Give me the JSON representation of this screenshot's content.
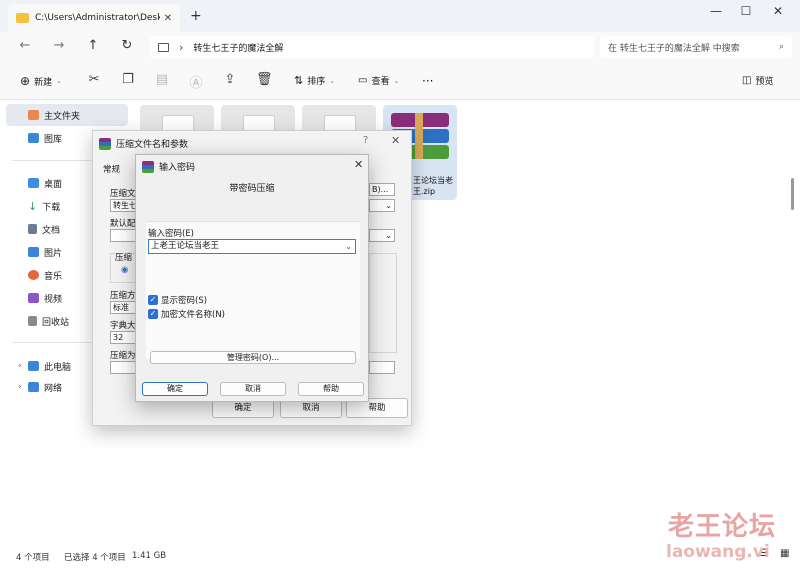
{
  "window": {
    "tab_title": "C:\\Users\\Administrator\\Deskto",
    "new_tab": "+",
    "minimize": "—",
    "maximize": "☐",
    "close": "✕"
  },
  "address": {
    "breadcrumb": "转生七王子的魔法全解",
    "search_placeholder": "在 转生七王子的魔法全解 中搜索"
  },
  "toolbar": {
    "new_label": "新建",
    "sort_label": "排序",
    "view_label": "查看",
    "more": "···",
    "preview_label": "预览"
  },
  "sidebar": {
    "items": [
      {
        "label": "主文件夹",
        "color": "#e8884f"
      },
      {
        "label": "图库",
        "color": "#3a86d8"
      },
      {
        "label": "桌面",
        "color": "#3d8ee0"
      },
      {
        "label": "下载",
        "color": "#2e9e57"
      },
      {
        "label": "文档",
        "color": "#6c7d92"
      },
      {
        "label": "图片",
        "color": "#3a86d8"
      },
      {
        "label": "音乐",
        "color": "#e5663f"
      },
      {
        "label": "视频",
        "color": "#8b56c9"
      },
      {
        "label": "回收站",
        "color": "#8a8a8a"
      },
      {
        "label": "此电脑",
        "color": "#3a86d8"
      },
      {
        "label": "网络",
        "color": "#3a86d8"
      }
    ]
  },
  "files": {
    "rar_label": "王论坛当老王.zip"
  },
  "status": {
    "count": "4 个项目",
    "selected": "已选择 4 个项目",
    "size": "1.41 GB"
  },
  "archive_dialog": {
    "title": "压缩文件名和参数",
    "help_q": "?",
    "close": "✕",
    "tab_general": "常规",
    "label_archive": "压缩文",
    "archive_name": "转生七",
    "label_default": "默认配",
    "label_format": "压缩",
    "label_method": "压缩方",
    "method_value": "标准",
    "label_dict": "字典大",
    "dict_value": "32",
    "label_split": "压缩为",
    "browse_btn": "B)...",
    "ok": "确定",
    "cancel": "取消",
    "help": "帮助"
  },
  "password_dialog": {
    "title": "输入密码",
    "close": "✕",
    "heading": "带密码压缩",
    "label_password": "输入密码(E)",
    "password_value": "上老王论坛当老王",
    "show_password": "显示密码(S)",
    "encrypt_names": "加密文件名称(N)",
    "manage_btn": "管理密码(O)...",
    "ok": "确定",
    "cancel": "取消",
    "help": "帮助"
  },
  "watermark": {
    "title": "老王论坛",
    "url": "laowang.vi"
  }
}
